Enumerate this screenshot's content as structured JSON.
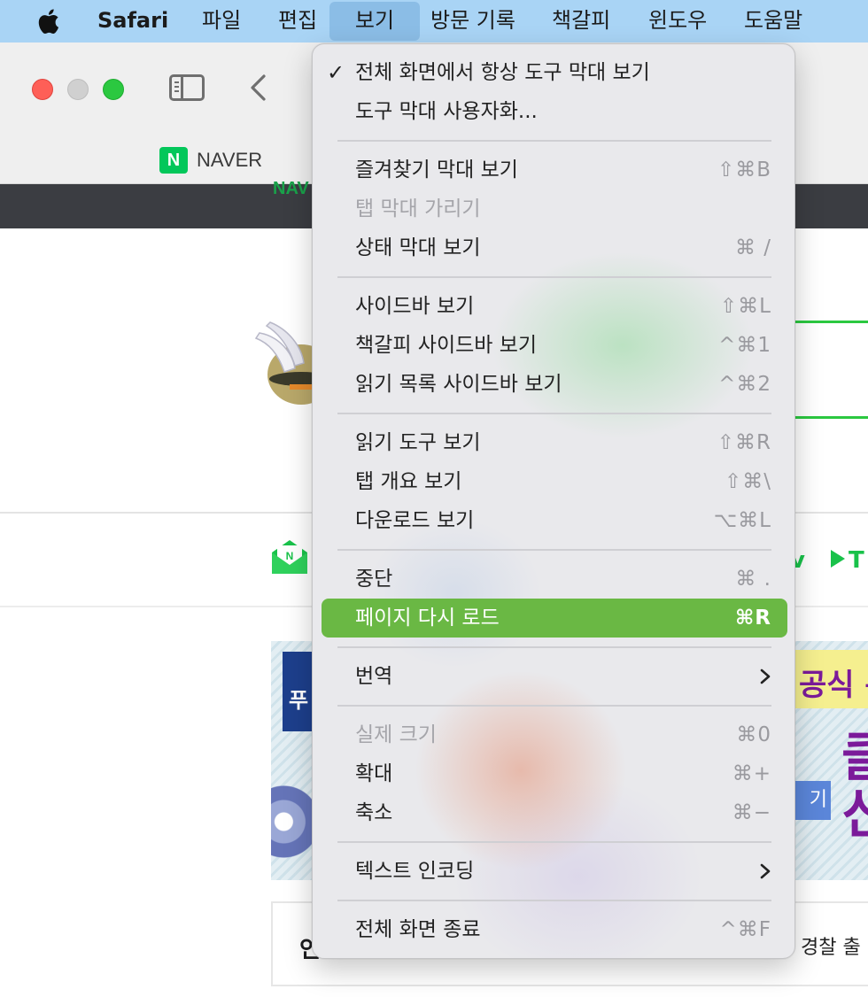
{
  "menubar": {
    "app_name": "Safari",
    "menus": [
      "파일",
      "편집",
      "보기",
      "방문 기록",
      "책갈피",
      "윈도우",
      "도움말"
    ],
    "selected_menu": "보기"
  },
  "toolbar": {
    "favorites": [
      {
        "icon": "N",
        "label": "NAVER"
      }
    ]
  },
  "page": {
    "topbar_peek": "NAV",
    "tv_peek": "T",
    "v_peek": "v",
    "mail_icon_letter": "N",
    "banner": {
      "tab_text": "푸",
      "corner_text": "공식 온",
      "big_text": "클\n신",
      "button_text": "기"
    },
    "news_left": "인",
    "news_right": "경찰 출"
  },
  "view_menu": {
    "items": [
      {
        "label": "전체 화면에서 항상 도구 막대 보기",
        "checked": true,
        "shortcut": ""
      },
      {
        "label": "도구 막대 사용자화...",
        "shortcut": ""
      },
      {
        "label": "즐겨찾기 막대 보기",
        "shortcut": "⇧⌘B"
      },
      {
        "label": "탭 막대 가리기",
        "shortcut": "",
        "disabled": true
      },
      {
        "label": "상태 막대 보기",
        "shortcut": "⌘ /"
      },
      {
        "label": "사이드바 보기",
        "shortcut": "⇧⌘L"
      },
      {
        "label": "책갈피 사이드바 보기",
        "shortcut": "^⌘1"
      },
      {
        "label": "읽기 목록 사이드바 보기",
        "shortcut": "^⌘2"
      },
      {
        "label": "읽기 도구 보기",
        "shortcut": "⇧⌘R"
      },
      {
        "label": "탭 개요 보기",
        "shortcut": "⇧⌘\\"
      },
      {
        "label": "다운로드 보기",
        "shortcut": "⌥⌘L"
      },
      {
        "label": "중단",
        "shortcut": "⌘ ."
      },
      {
        "label": "페이지 다시 로드",
        "shortcut": "⌘R",
        "highlighted": true
      },
      {
        "label": "번역",
        "submenu": true
      },
      {
        "label": "실제 크기",
        "shortcut": "⌘0",
        "disabled": true
      },
      {
        "label": "확대",
        "shortcut": "⌘+"
      },
      {
        "label": "축소",
        "shortcut": "⌘−"
      },
      {
        "label": "텍스트 인코딩",
        "submenu": true
      },
      {
        "label": "전체 화면 종료",
        "shortcut": "^⌘F"
      }
    ],
    "check_glyph": "✓"
  },
  "colors": {
    "menubar_bg": "#a9d4f5",
    "highlight": "#6ab844",
    "naver_green": "#03c75a"
  }
}
